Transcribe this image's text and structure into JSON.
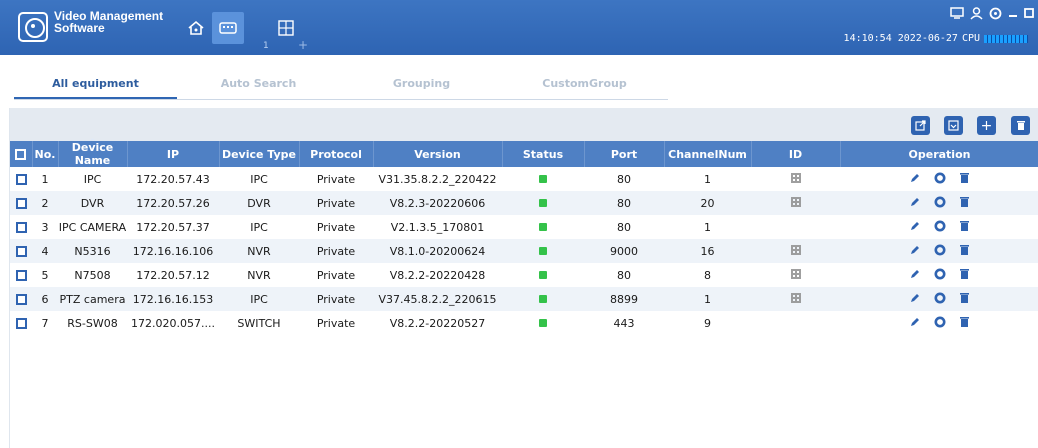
{
  "app": {
    "title": "Video Management Software"
  },
  "topbar": {
    "nav_counter": "1",
    "nav_add": "+",
    "datetime": "14:10:54 2022-06-27",
    "cpu_label": "CPU",
    "window_controls": [
      "monitor-icon",
      "user-icon",
      "settings-icon",
      "minimize-icon",
      "maximize-icon",
      "close-icon"
    ]
  },
  "tabs": [
    {
      "label": "All equipment",
      "active": true
    },
    {
      "label": "Auto Search",
      "active": false
    },
    {
      "label": "Grouping",
      "active": false
    },
    {
      "label": "CustomGroup",
      "active": false
    }
  ],
  "toolbar": {
    "buttons": [
      "export-icon",
      "import-icon",
      "add-icon",
      "delete-icon"
    ],
    "add_label": "+"
  },
  "table": {
    "headers": {
      "no": "No.",
      "device_name": "Device Name",
      "ip": "IP",
      "device_type": "Device Type",
      "protocol": "Protocol",
      "version": "Version",
      "status": "Status",
      "port": "Port",
      "channel_num": "ChannelNum",
      "id": "ID",
      "operation": "Operation"
    },
    "sort_indicator": "^",
    "rows": [
      {
        "no": "1",
        "device_name": "IPC",
        "ip": "172.20.57.43",
        "device_type": "IPC",
        "protocol": "Private",
        "version": "V31.35.8.2.2_220422",
        "status": "online",
        "port": "80",
        "channel_num": "1",
        "has_qr": true
      },
      {
        "no": "2",
        "device_name": "DVR",
        "ip": "172.20.57.26",
        "device_type": "DVR",
        "protocol": "Private",
        "version": "V8.2.3-20220606",
        "status": "online",
        "port": "80",
        "channel_num": "20",
        "has_qr": true
      },
      {
        "no": "3",
        "device_name": "IPC CAMERA",
        "ip": "172.20.57.37",
        "device_type": "IPC",
        "protocol": "Private",
        "version": "V2.1.3.5_170801",
        "status": "online",
        "port": "80",
        "channel_num": "1",
        "has_qr": false
      },
      {
        "no": "4",
        "device_name": "N5316",
        "ip": "172.16.16.106",
        "device_type": "NVR",
        "protocol": "Private",
        "version": "V8.1.0-20200624",
        "status": "online",
        "port": "9000",
        "channel_num": "16",
        "has_qr": true
      },
      {
        "no": "5",
        "device_name": "N7508",
        "ip": "172.20.57.12",
        "device_type": "NVR",
        "protocol": "Private",
        "version": "V8.2.2-20220428",
        "status": "online",
        "port": "80",
        "channel_num": "8",
        "has_qr": true
      },
      {
        "no": "6",
        "device_name": "PTZ camera",
        "ip": "172.16.16.153",
        "device_type": "IPC",
        "protocol": "Private",
        "version": "V37.45.8.2.2_220615",
        "status": "online",
        "port": "8899",
        "channel_num": "1",
        "has_qr": true
      },
      {
        "no": "7",
        "device_name": "RS-SW08",
        "ip": "172.020.057....",
        "device_type": "SWITCH",
        "protocol": "Private",
        "version": "V8.2.2-20220527",
        "status": "online",
        "port": "443",
        "channel_num": "9",
        "has_qr": false
      }
    ]
  },
  "colors": {
    "titlebar": "#3469b8",
    "header": "#4f80c4",
    "accent": "#2f63b1",
    "status_online": "#34c24a"
  }
}
